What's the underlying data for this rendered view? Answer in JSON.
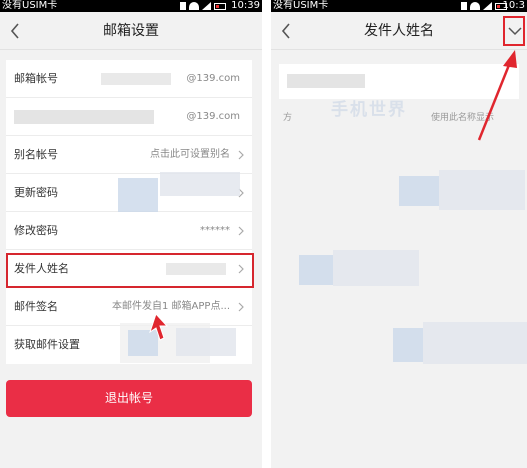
{
  "status_bar": {
    "left_carrier": "没有USIM卡",
    "left_time": "10:39",
    "right_carrier": "没有USIM卡",
    "right_time": "10:3"
  },
  "mailbox_settings": {
    "title": "邮箱设置",
    "rows": [
      {
        "label": "邮箱帐号",
        "value": "@139.com"
      },
      {
        "label": "",
        "value": "@139.com"
      },
      {
        "label": "别名帐号",
        "value": "点击此可设置别名"
      },
      {
        "label": "更新密码",
        "value": ""
      },
      {
        "label": "修改密码",
        "value": "******"
      },
      {
        "label": "发件人姓名",
        "value": ""
      },
      {
        "label": "邮件签名",
        "value": "本邮件发自1  邮箱APP点..."
      },
      {
        "label": "获取邮件设置",
        "value": ""
      }
    ],
    "logout_label": "退出帐号"
  },
  "sender_name": {
    "title": "发件人姓名",
    "hint_start": "方",
    "hint_end": "使用此名称显示",
    "watermark": "手机世界"
  },
  "colors": {
    "accent_red": "#ea2e46",
    "highlight_red": "#d6262e",
    "background": "#f2f2f2"
  },
  "icons": {
    "back": "chevron-left-icon",
    "chevron": "chevron-right-icon",
    "confirm": "checkmark-icon"
  }
}
